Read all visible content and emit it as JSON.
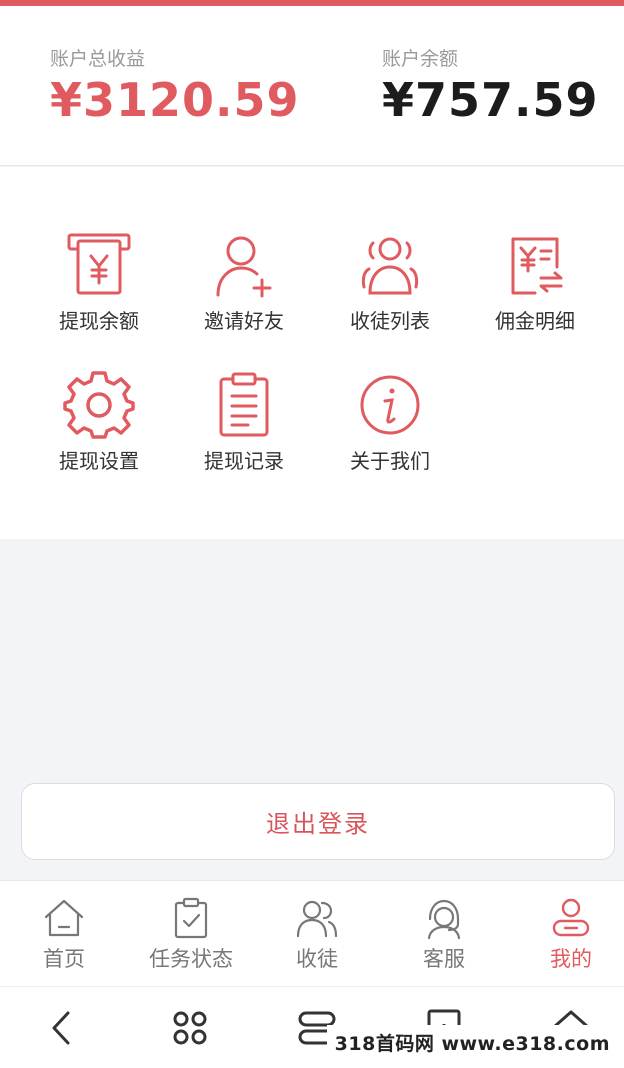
{
  "accent_color": "#e05b5f",
  "stats": {
    "total_earnings": {
      "label": "账户总收益",
      "value": "¥3120.59"
    },
    "balance": {
      "label": "账户余额",
      "value": "¥757.59"
    }
  },
  "menu": {
    "items": [
      {
        "label": "提现余额",
        "icon": "atm-yuan-icon"
      },
      {
        "label": "邀请好友",
        "icon": "add-user-icon"
      },
      {
        "label": "收徒列表",
        "icon": "group-icon"
      },
      {
        "label": "佣金明细",
        "icon": "commission-detail-icon"
      },
      {
        "label": "提现设置",
        "icon": "gear-icon"
      },
      {
        "label": "提现记录",
        "icon": "clipboard-list-icon"
      },
      {
        "label": "关于我们",
        "icon": "info-icon"
      }
    ]
  },
  "logout": {
    "label": "退出登录"
  },
  "tabbar": {
    "active": "我的",
    "tabs": [
      {
        "label": "首页",
        "icon": "home-icon"
      },
      {
        "label": "任务状态",
        "icon": "task-check-icon"
      },
      {
        "label": "收徒",
        "icon": "users-icon"
      },
      {
        "label": "客服",
        "icon": "headset-icon"
      },
      {
        "label": "我的",
        "icon": "profile-icon"
      }
    ]
  },
  "system_nav": {
    "buttons": [
      "back-icon",
      "shortcut-icon",
      "recent-apps-icon",
      "tabs-count-icon",
      "home-icon"
    ],
    "tabs_count": "1"
  },
  "watermark": {
    "text": "318首码网 www.e318.com"
  }
}
